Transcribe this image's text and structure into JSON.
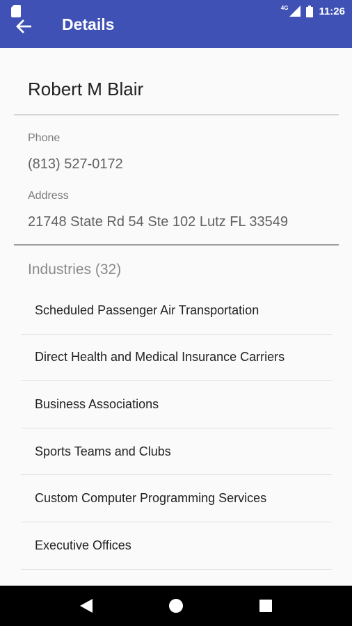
{
  "status_bar": {
    "network": "4G",
    "time": "11:26",
    "icons": [
      "sd-card-icon",
      "cell-signal-icon",
      "battery-icon"
    ]
  },
  "app_bar": {
    "title": "Details",
    "back_icon": "arrow-left-icon",
    "color": "#3f51b5"
  },
  "contact": {
    "name": "Robert M Blair",
    "phone_label": "Phone",
    "phone": "(813) 527-0172",
    "address_label": "Address",
    "address": "21748 State Rd 54 Ste 102 Lutz FL 33549"
  },
  "industries": {
    "header": "Industries (32)",
    "items": [
      "Scheduled Passenger Air Transportation",
      "Direct Health and Medical Insurance Carriers",
      "Business Associations",
      "Sports Teams and Clubs",
      "Custom Computer Programming Services",
      "Executive Offices"
    ]
  },
  "nav_bar": {
    "icons": [
      "back-triangle-icon",
      "home-circle-icon",
      "recents-square-icon"
    ]
  }
}
